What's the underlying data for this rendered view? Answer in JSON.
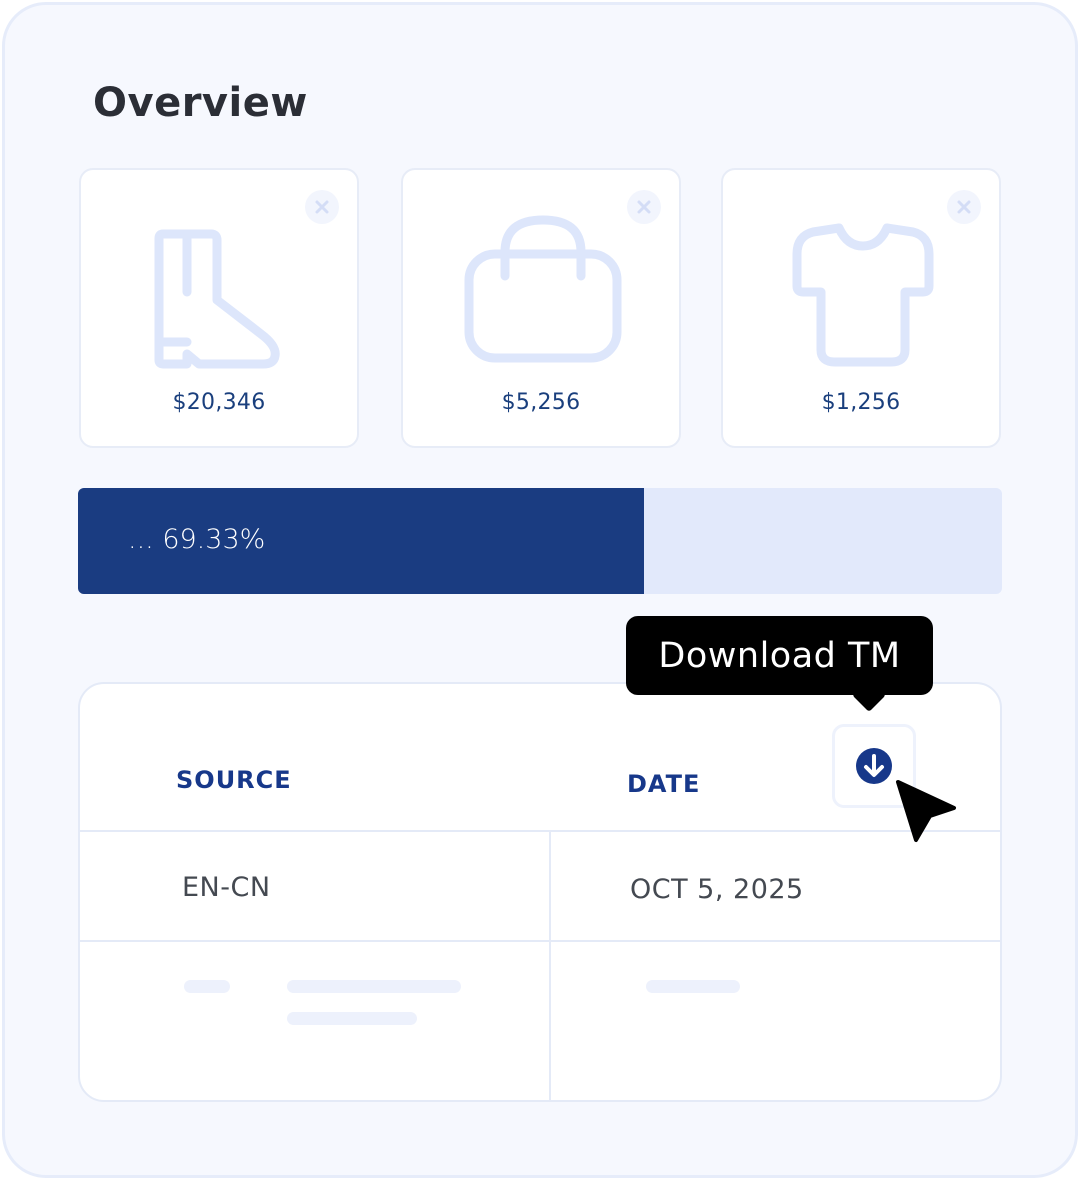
{
  "page": {
    "title": "Overview"
  },
  "cards": [
    {
      "icon": "boot-icon",
      "price": "$20,346"
    },
    {
      "icon": "bag-icon",
      "price": "$5,256"
    },
    {
      "icon": "tshirt-icon",
      "price": "$1,256"
    }
  ],
  "progress": {
    "label": "... 69.33%",
    "value_percent": 61.3
  },
  "tooltip": {
    "text": "Download TM"
  },
  "table": {
    "headers": {
      "source": "SOURCE",
      "date": "DATE"
    },
    "rows": [
      {
        "source": "EN-CN",
        "date": "OCT 5, 2025"
      }
    ]
  },
  "colors": {
    "accent": "#1a3c81",
    "progress_track": "#e2e9fb",
    "header_text": "#17388a",
    "icon_outline": "#dde6fb"
  }
}
